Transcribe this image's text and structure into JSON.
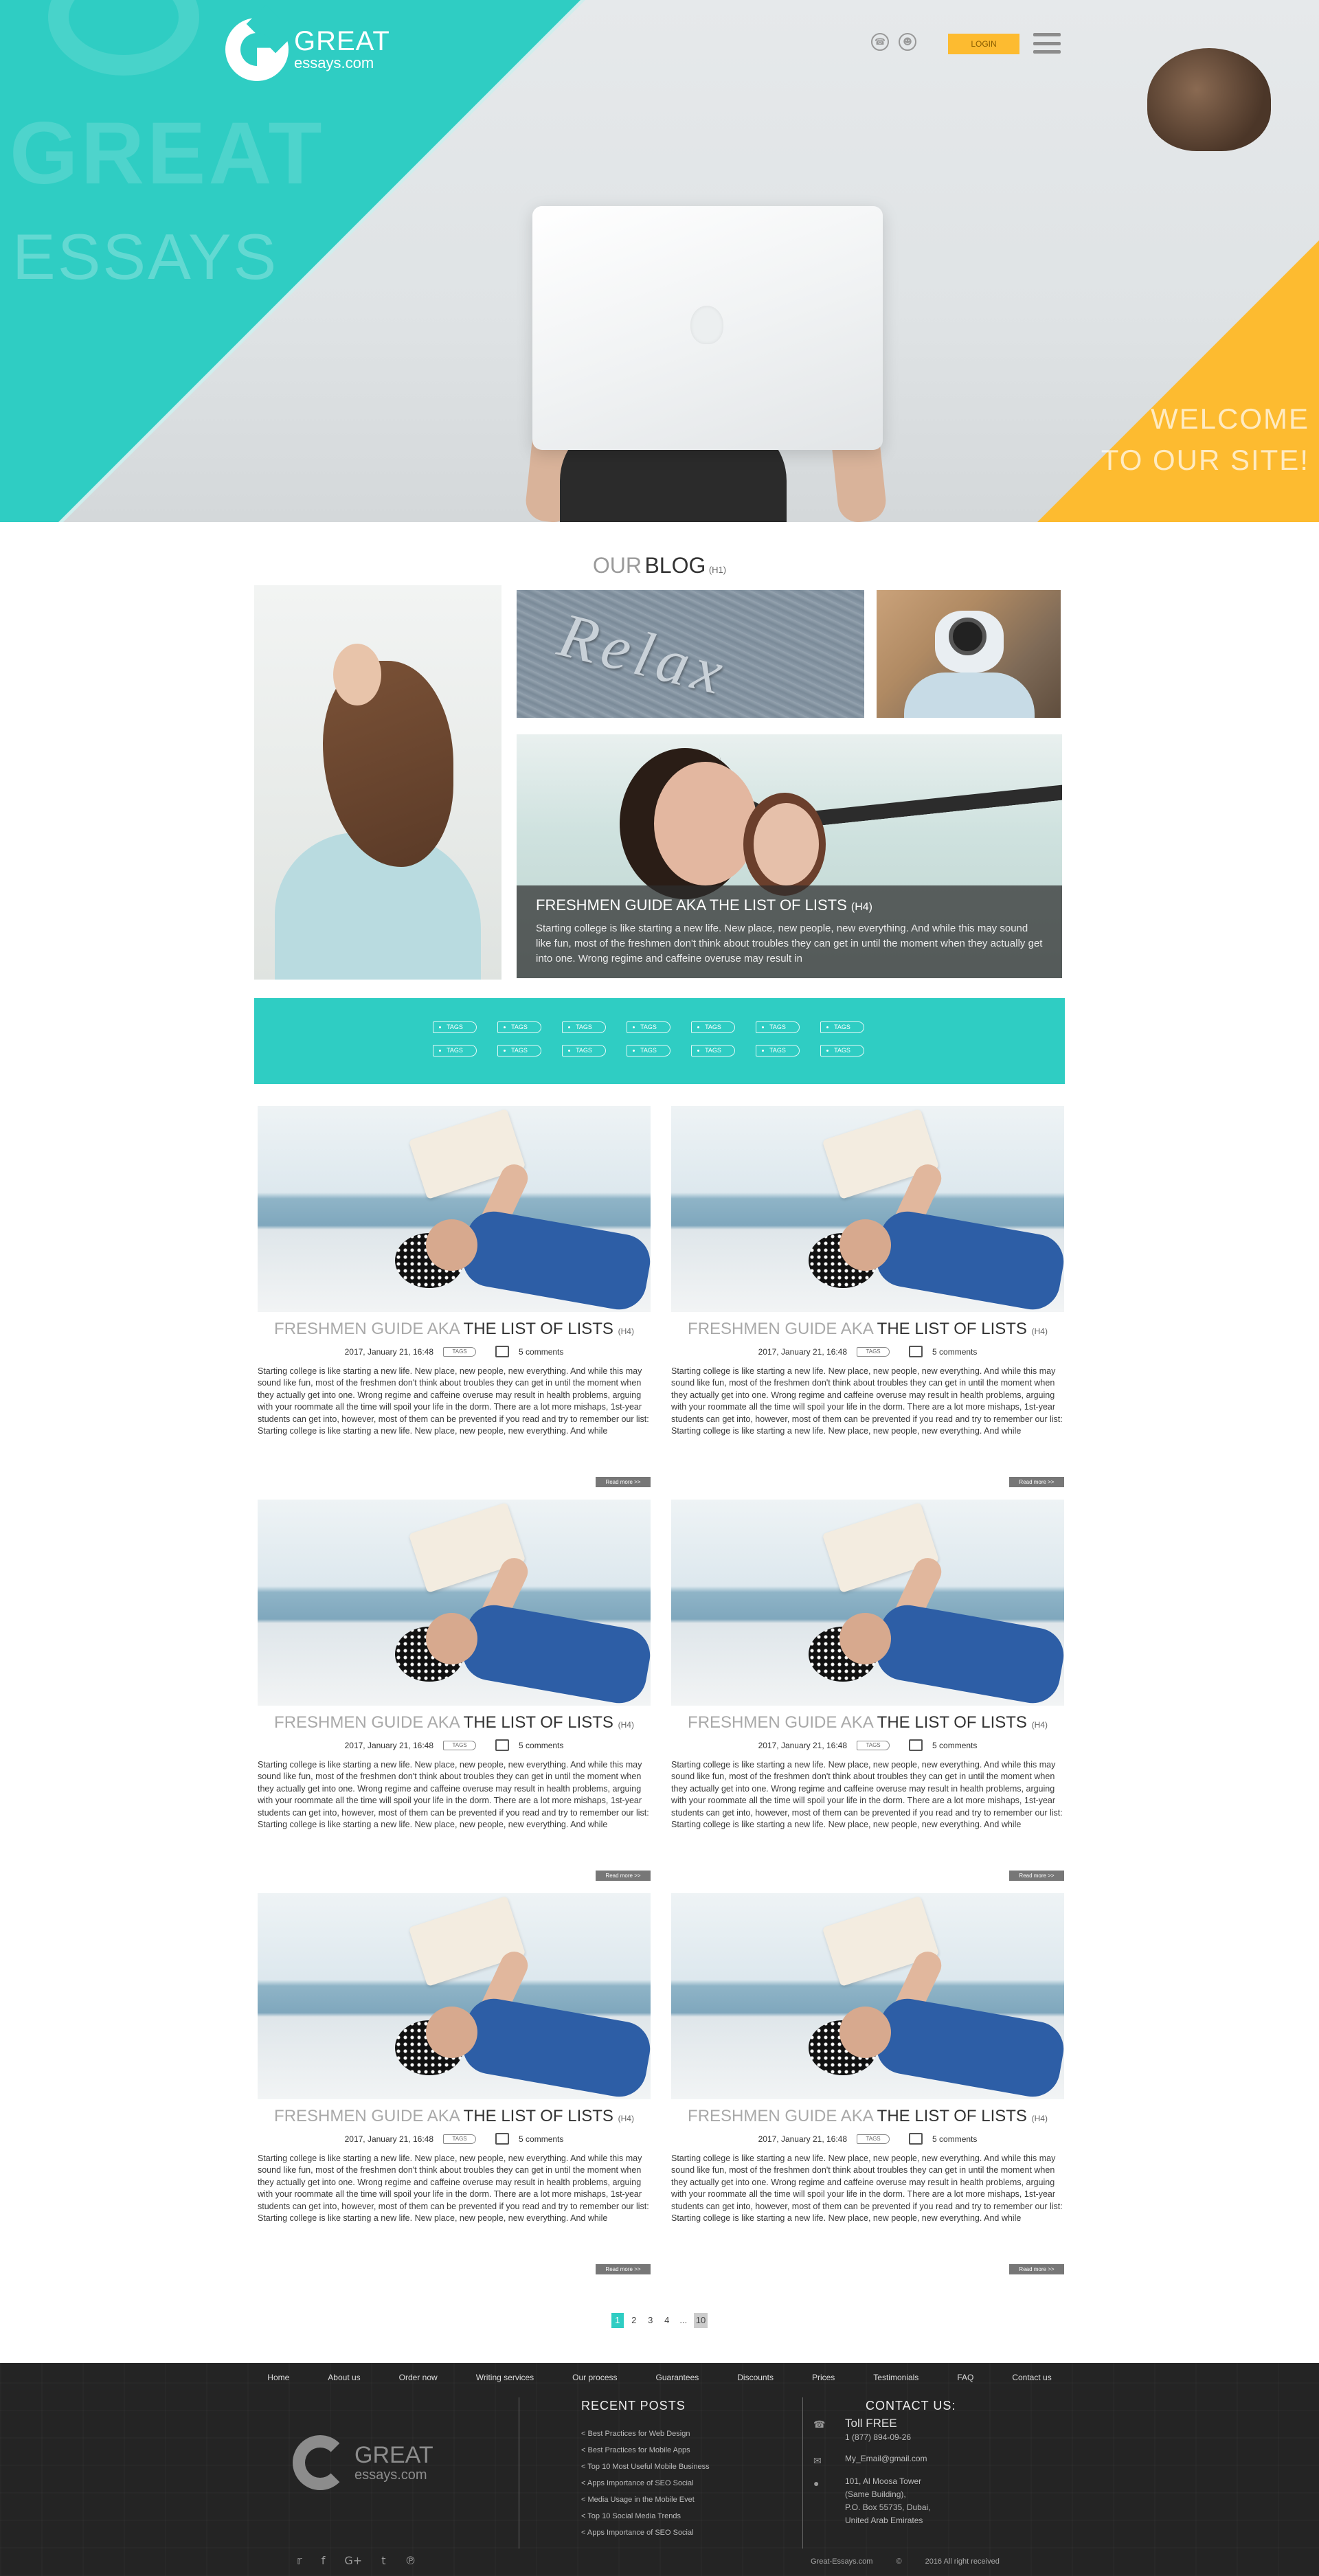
{
  "header": {
    "logo_name": "GREAT",
    "logo_sub": "essays.com",
    "ghost_great": "GREAT",
    "ghost_essays": "ESSAYS",
    "phone_icon": "phone-icon",
    "user_icon": "user-icon",
    "login_label": "LOGIN",
    "welcome_line1": "WELCOME",
    "welcome_line2": "TO OUR SITE!"
  },
  "blog": {
    "title_light": "OUR",
    "title_dark": "BLOG",
    "title_tag": "(H1)",
    "featured": {
      "sand_word": "Relax",
      "title": "FRESHMEN GUIDE AKA THE LIST OF LISTS",
      "title_tag": "(H4)",
      "excerpt": "Starting college is like starting a new life. New place, new people, new everything. And while this may sound like fun, most of the freshmen don't think about troubles they can get in until the moment when they actually get into one. Wrong regime and caffeine overuse may result in"
    }
  },
  "tags": {
    "label": "TAGS",
    "row1": [
      "TAGS",
      "TAGS",
      "TAGS",
      "TAGS",
      "TAGS",
      "TAGS",
      "TAGS"
    ],
    "row2": [
      "TAGS",
      "TAGS",
      "TAGS",
      "TAGS",
      "TAGS",
      "TAGS",
      "TAGS"
    ]
  },
  "post": {
    "title_light": "FRESHMEN GUIDE AKA",
    "title_dark": "THE LIST OF LISTS",
    "title_tag": "(H4)",
    "date": "2017, January 21, 16:48",
    "tag": "TAGS",
    "comments": "5 comments",
    "body": "Starting college is like starting a new life. New place, new people, new everything. And while this may sound like fun, most of the freshmen don't think about troubles they can get in until the moment when they actually get into one. Wrong regime and caffeine overuse may result in health problems, arguing with your roommate all the time will spoil your life in the dorm. There are a lot more mishaps, 1st-year students can get into, however, most of them can be prevented if you read and try to remember our list:",
    "body_extra": "Starting college is like starting a new life. New place, new people, new everything. And while",
    "read_more": "Read more >>"
  },
  "pagination": {
    "pages": [
      "1",
      "2",
      "3",
      "4",
      "...",
      "10"
    ],
    "active": "1"
  },
  "footer": {
    "nav": [
      "Home",
      "About us",
      "Order now",
      "Writing services",
      "Our process",
      "Guarantees",
      "Discounts",
      "Prices",
      "Testimonials",
      "FAQ",
      "Contact us"
    ],
    "logo_name": "GREAT",
    "logo_sub": "essays.com",
    "recent_title": "RECENT POSTS",
    "recent_posts": [
      "< Best Practices for Web Design",
      "< Best Practices for Mobile Apps",
      "< Top 10 Most Useful Mobile Business",
      "< Apps Importance of SEO Social",
      "< Media Usage in the Mobile Evet",
      "< Top 10 Social Media Trends",
      "< Apps Importance of SEO Social"
    ],
    "contact_title": "CONTACT US:",
    "toll_free": "Toll FREE",
    "phone": "1 (877) 894-09-26",
    "email": "My_Email@gmail.com",
    "address": [
      "101, Al Moosa Tower",
      "(Same Building),",
      "P.O. Box 55735, Dubai,",
      "United Arab Emirates"
    ],
    "socials": [
      "twitter-icon",
      "facebook-icon",
      "google-plus-icon",
      "tumblr-icon",
      "pinterest-icon"
    ],
    "site": "Great-Essays.com",
    "copyright": "2016 All right received"
  }
}
